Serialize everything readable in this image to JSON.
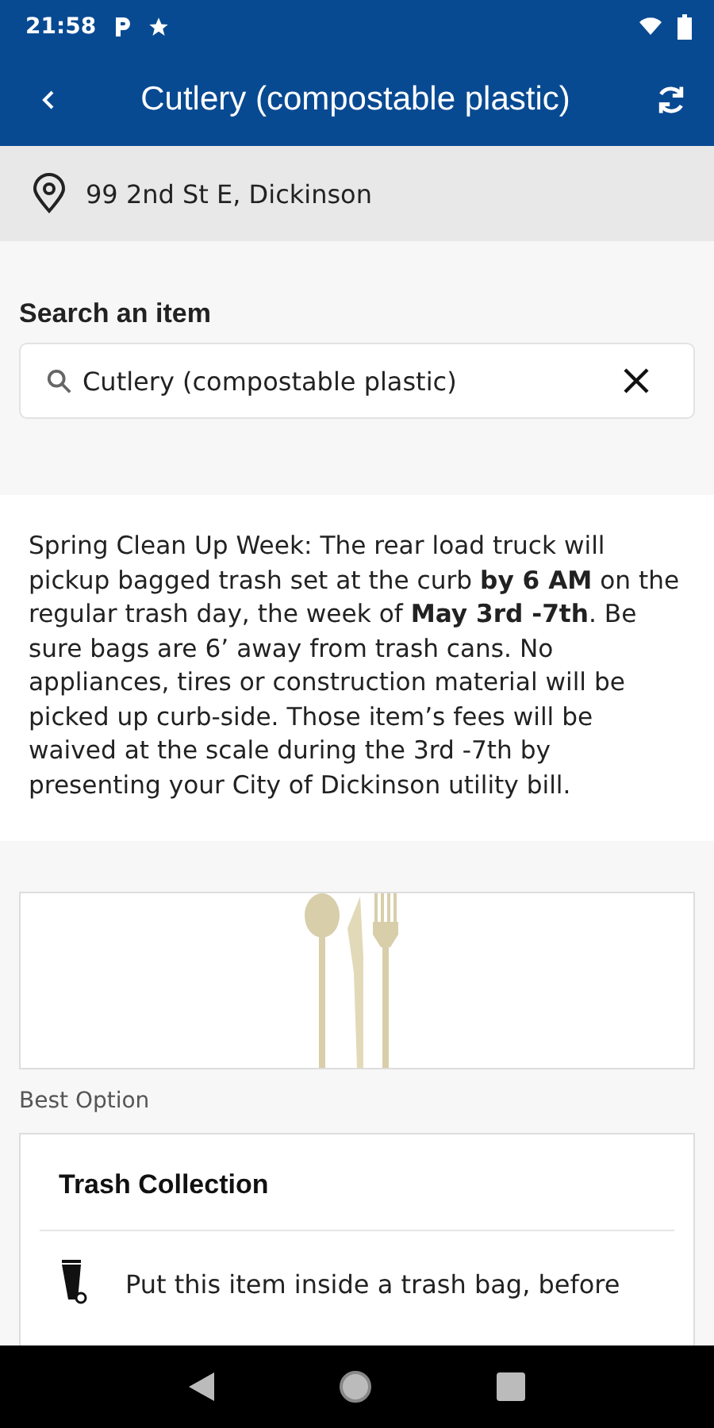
{
  "status_bar": {
    "time": "21:58"
  },
  "app_bar": {
    "title": "Cutlery (compostable plastic)"
  },
  "address": {
    "text": "99 2nd St E, Dickinson"
  },
  "search": {
    "label": "Search an item",
    "value": "Cutlery (compostable plastic)"
  },
  "announcement": {
    "text": "Spring Clean Up Week: The rear load truck will pickup bagged trash set at the curb **by 6 AM** on the regular trash day, the week of **May 3rd -7th**. Be sure bags are 6’ away from trash cans. No appliances, tires or construction material will be picked up curb-side. Those item’s fees will be waived at the scale during the 3rd -7th by presenting your City of Dickinson utility bill."
  },
  "best_option": {
    "label": "Best Option",
    "title": "Trash Collection",
    "instruction": "Put this item inside a trash bag, before"
  }
}
